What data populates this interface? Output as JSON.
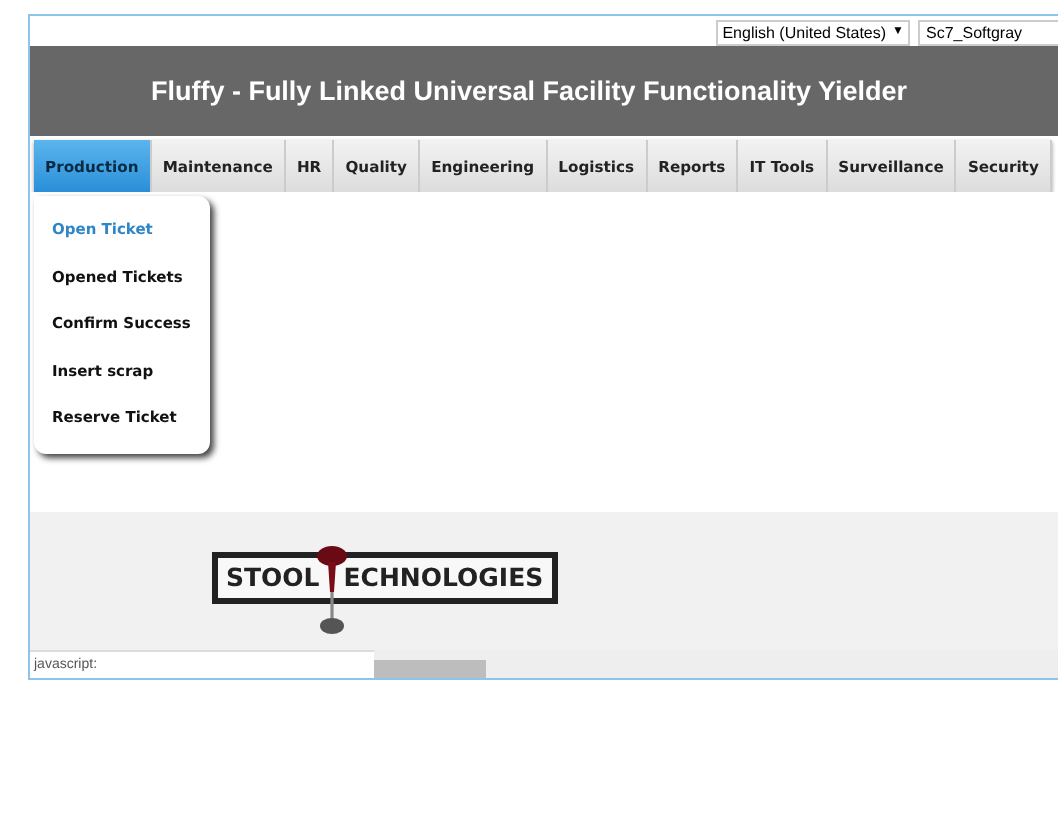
{
  "top_bar": {
    "language": "English (United States)",
    "dropdown_arrow": "▼",
    "user": "Sc7_Softgray"
  },
  "header": {
    "title": "Fluffy - Fully Linked Universal Facility Functionality Yielder"
  },
  "tabs": [
    {
      "label": "Production",
      "selected": true
    },
    {
      "label": "Maintenance",
      "selected": false
    },
    {
      "label": "HR",
      "selected": false
    },
    {
      "label": "Quality",
      "selected": false
    },
    {
      "label": "Engineering",
      "selected": false
    },
    {
      "label": "Logistics",
      "selected": false
    },
    {
      "label": "Reports",
      "selected": false
    },
    {
      "label": "IT Tools",
      "selected": false
    },
    {
      "label": "Surveillance",
      "selected": false
    },
    {
      "label": "Security",
      "selected": false
    }
  ],
  "menu": {
    "items": [
      {
        "label": "Open Ticket",
        "selected": true
      },
      {
        "label": "Opened Tickets",
        "selected": false
      },
      {
        "label": "Confirm Success",
        "selected": false
      },
      {
        "label": "Insert scrap",
        "selected": false
      },
      {
        "label": "Reserve Ticket",
        "selected": false
      }
    ]
  },
  "logo": {
    "left_text": "STOOL",
    "right_text": "ECHNOLOGIES"
  },
  "status_bar": {
    "text": "javascript:"
  }
}
